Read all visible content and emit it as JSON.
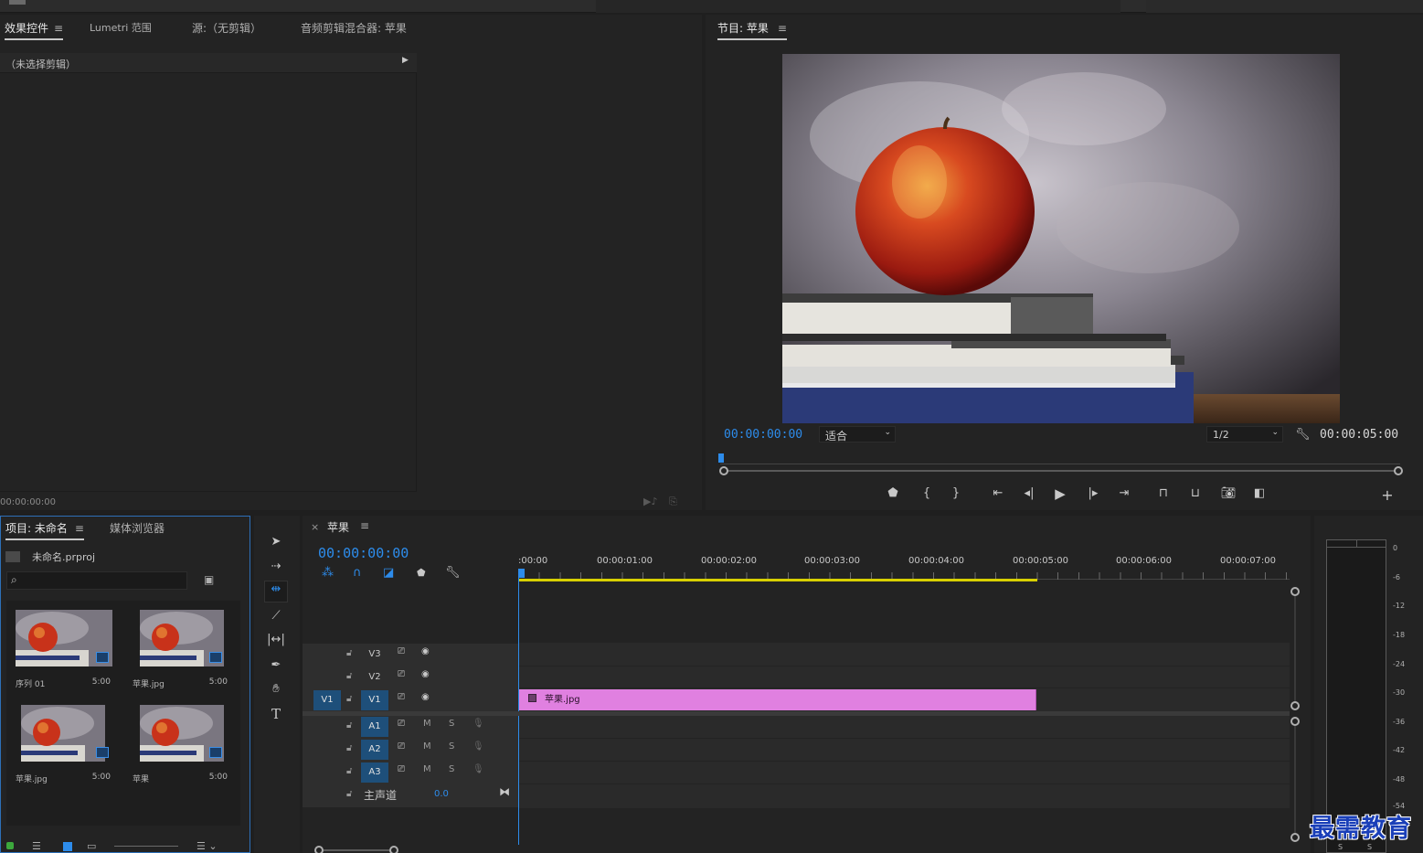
{
  "effects_panel": {
    "tabs": [
      "效果控件",
      "Lumetri 范围",
      "源:（无剪辑）",
      "音频剪辑混合器: 苹果"
    ],
    "menu_glyph": "≡",
    "no_clip": "（未选择剪辑）",
    "timecode": "00:00:00:00"
  },
  "program_monitor": {
    "title": "节目: 苹果",
    "menu_glyph": "≡",
    "timecode_current": "00:00:00:00",
    "fit": "适合",
    "resolution": "1/2",
    "timecode_duration": "00:00:05:00"
  },
  "project_panel": {
    "tabs": [
      "项目: 未命名",
      "媒体浏览器"
    ],
    "menu_glyph": "≡",
    "file_name": "未命名.prproj",
    "search_placeholder": "",
    "items": [
      {
        "label": "序列 01",
        "dur": "5:00",
        "badge": "sequence-icon"
      },
      {
        "label": "苹果.jpg",
        "dur": "5:00",
        "badge": "image-icon"
      },
      {
        "label": "苹果.jpg",
        "dur": "5:00",
        "badge": "image-icon"
      },
      {
        "label": "苹果",
        "dur": "5:00",
        "badge": "sequence-icon"
      }
    ]
  },
  "timeline": {
    "tab_close": "×",
    "title": "苹果",
    "menu_glyph": "≡",
    "timecode": "00:00:00:00",
    "ruler": [
      ":00:00",
      "00:00:01:00",
      "00:00:02:00",
      "00:00:03:00",
      "00:00:04:00",
      "00:00:05:00",
      "00:00:06:00",
      "00:00:07:00"
    ],
    "video_tracks": [
      "V3",
      "V2",
      "V1"
    ],
    "source_patch": "V1",
    "audio_tracks": [
      "A1",
      "A2",
      "A3"
    ],
    "mute_label": "M",
    "solo_label": "S",
    "master_label": "主声道",
    "master_value": "0.0",
    "clip_label": "苹果.jpg",
    "clip_color": "#e080e0"
  },
  "audio_meter": {
    "scale": [
      "0",
      "-6",
      "-12",
      "-18",
      "-24",
      "-30",
      "-36",
      "-42",
      "-48",
      "-54"
    ],
    "solo": [
      "S",
      "S"
    ]
  },
  "watermark": "最需教育",
  "colors": {
    "accent": "#2d8ceb",
    "clip": "#e080e0",
    "work_area": "#d8d000"
  }
}
